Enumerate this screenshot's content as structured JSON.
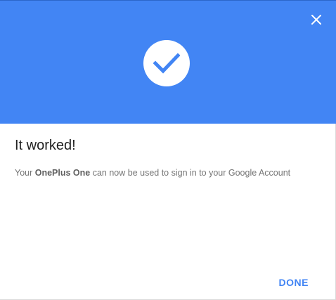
{
  "header": {
    "icon": "checkmark-icon",
    "close_icon": "close-icon",
    "accent_color": "#4285f4"
  },
  "content": {
    "title": "It worked!",
    "message_prefix": "Your ",
    "device_name": "OnePlus One",
    "message_suffix": " can now be used to sign in to your Google Account"
  },
  "actions": {
    "done_label": "DONE"
  }
}
